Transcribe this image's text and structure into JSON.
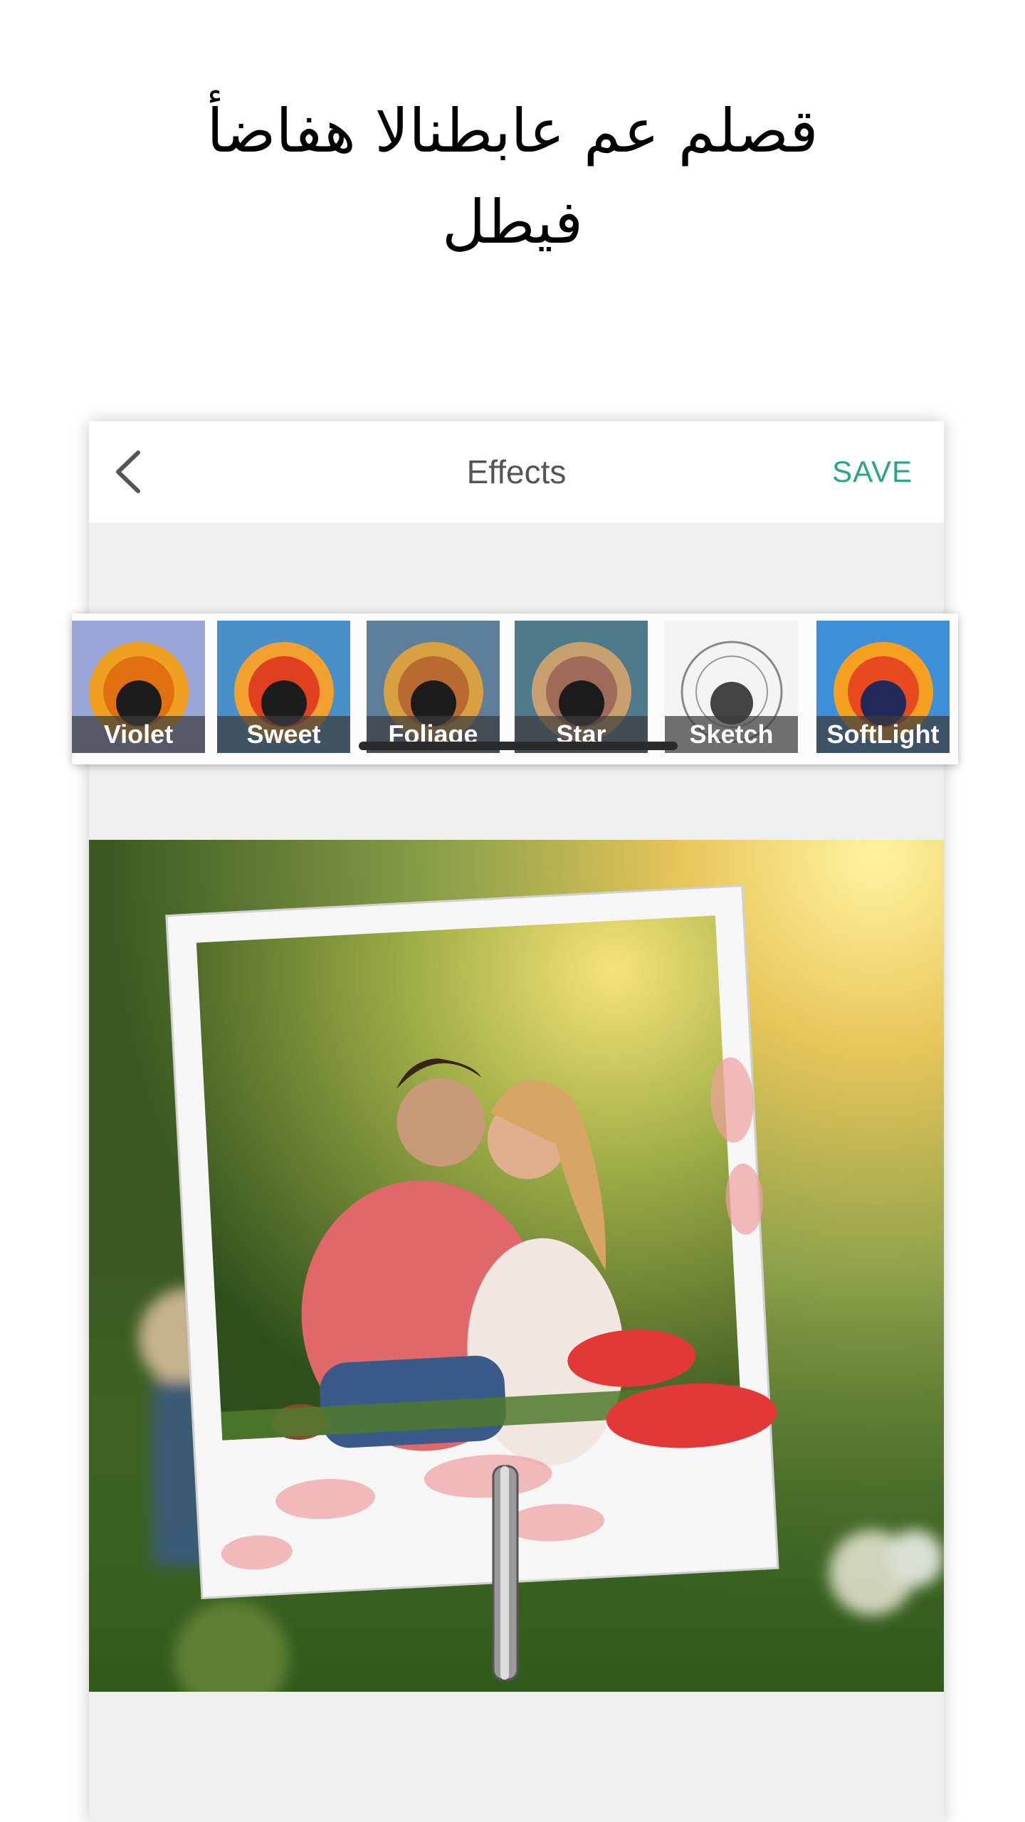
{
  "headline": {
    "line1": "قصلم عم عابطنالا هفاضأ",
    "line2": "فيطل"
  },
  "nav": {
    "title": "Effects",
    "save_label": "SAVE",
    "back_icon": "chevron-left-icon"
  },
  "effects": [
    {
      "label": "Violet",
      "tint": "#9aa5d8"
    },
    {
      "label": "Sweet",
      "tint": "#4a90c8"
    },
    {
      "label": "Foliage",
      "tint": "#5d7f9a"
    },
    {
      "label": "Star",
      "tint": "#4f7a8c"
    },
    {
      "label": "Sketch",
      "tint": "#f4f4f4"
    },
    {
      "label": "SoftLight",
      "tint": "#3d8fd8"
    }
  ],
  "colors": {
    "accent": "#2aa58a",
    "title": "#555555",
    "canvas_bg": "#efefef"
  }
}
